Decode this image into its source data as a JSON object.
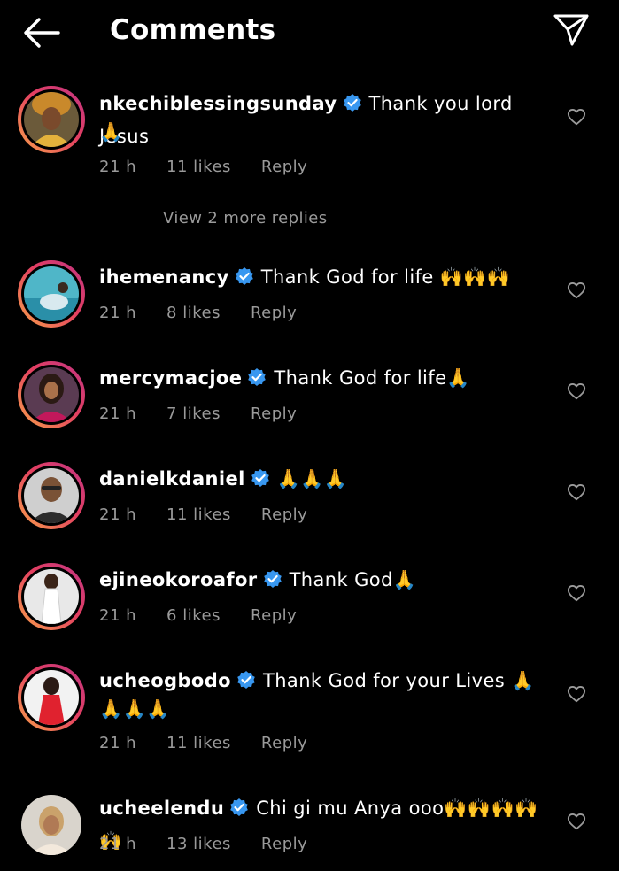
{
  "header": {
    "title": "Comments",
    "back_icon": "arrow-left-icon",
    "share_icon": "paper-plane-icon"
  },
  "colors": {
    "background": "#000000",
    "verified": "#3897f0",
    "meta_text": "#9a9a9a",
    "story_ring_start": "#f9a24a",
    "story_ring_end": "#c13584"
  },
  "comments": [
    {
      "username": "nkechiblessingsunday",
      "text_line1": "Thank you lord Jesus",
      "text_line2": "🙏",
      "time": "21 h",
      "likes": "11 likes",
      "reply_label": "Reply",
      "view_replies": "View 2 more replies"
    },
    {
      "username": "ihemenancy",
      "text_line1": "Thank God for life 🙌🙌🙌",
      "time": "21 h",
      "likes": "8 likes",
      "reply_label": "Reply"
    },
    {
      "username": "mercymacjoe",
      "text_line1": "Thank God for life🙏",
      "time": "21 h",
      "likes": "7 likes",
      "reply_label": "Reply"
    },
    {
      "username": "danielkdaniel",
      "text_line1": "🙏🙏🙏",
      "time": "21 h",
      "likes": "11 likes",
      "reply_label": "Reply"
    },
    {
      "username": "ejineokoroafor",
      "text_line1": "Thank God🙏",
      "time": "21 h",
      "likes": "6 likes",
      "reply_label": "Reply"
    },
    {
      "username": "ucheogbodo",
      "text_line1": "Thank God for your Lives 🙏",
      "text_line2": "🙏🙏🙏",
      "time": "21 h",
      "likes": "11 likes",
      "reply_label": "Reply"
    },
    {
      "username": "ucheelendu",
      "text_line1": "Chi gi mu Anya ooo🙌🙌🙌🙌🙌",
      "time": "21 h",
      "likes": "13 likes",
      "reply_label": "Reply"
    }
  ]
}
